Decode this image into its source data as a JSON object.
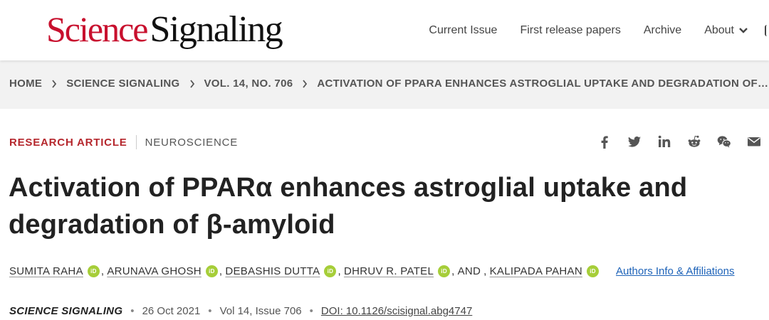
{
  "header": {
    "logo_science": "Science",
    "logo_signaling": "Signaling",
    "nav": [
      "Current Issue",
      "First release papers",
      "Archive",
      "About"
    ]
  },
  "breadcrumb": [
    "HOME",
    "SCIENCE SIGNALING",
    "VOL. 14, NO. 706",
    "ACTIVATION OF PPARA ENHANCES ASTROGLIAL UPTAKE AND DEGRADATION OF B..."
  ],
  "article": {
    "type": "RESEARCH ARTICLE",
    "category": "NEUROSCIENCE",
    "title": "Activation of PPARα enhances astroglial uptake and degradation of β-amyloid",
    "authors": [
      "SUMITA RAHA",
      "ARUNAVA GHOSH",
      "DEBASHIS DUTTA",
      "DHRUV R. PATEL",
      "KALIPADA PAHAN"
    ],
    "and_label": "AND",
    "orcid_label": "iD",
    "affiliations_link": "Authors Info & Affiliations",
    "journal": "SCIENCE SIGNALING",
    "date": "26 Oct 2021",
    "volume_issue": "Vol 14, Issue 706",
    "doi": "DOI: 10.1126/scisignal.abg4747"
  },
  "share_icons": [
    "facebook-icon",
    "twitter-icon",
    "linkedin-icon",
    "reddit-icon",
    "wechat-icon",
    "email-icon"
  ]
}
